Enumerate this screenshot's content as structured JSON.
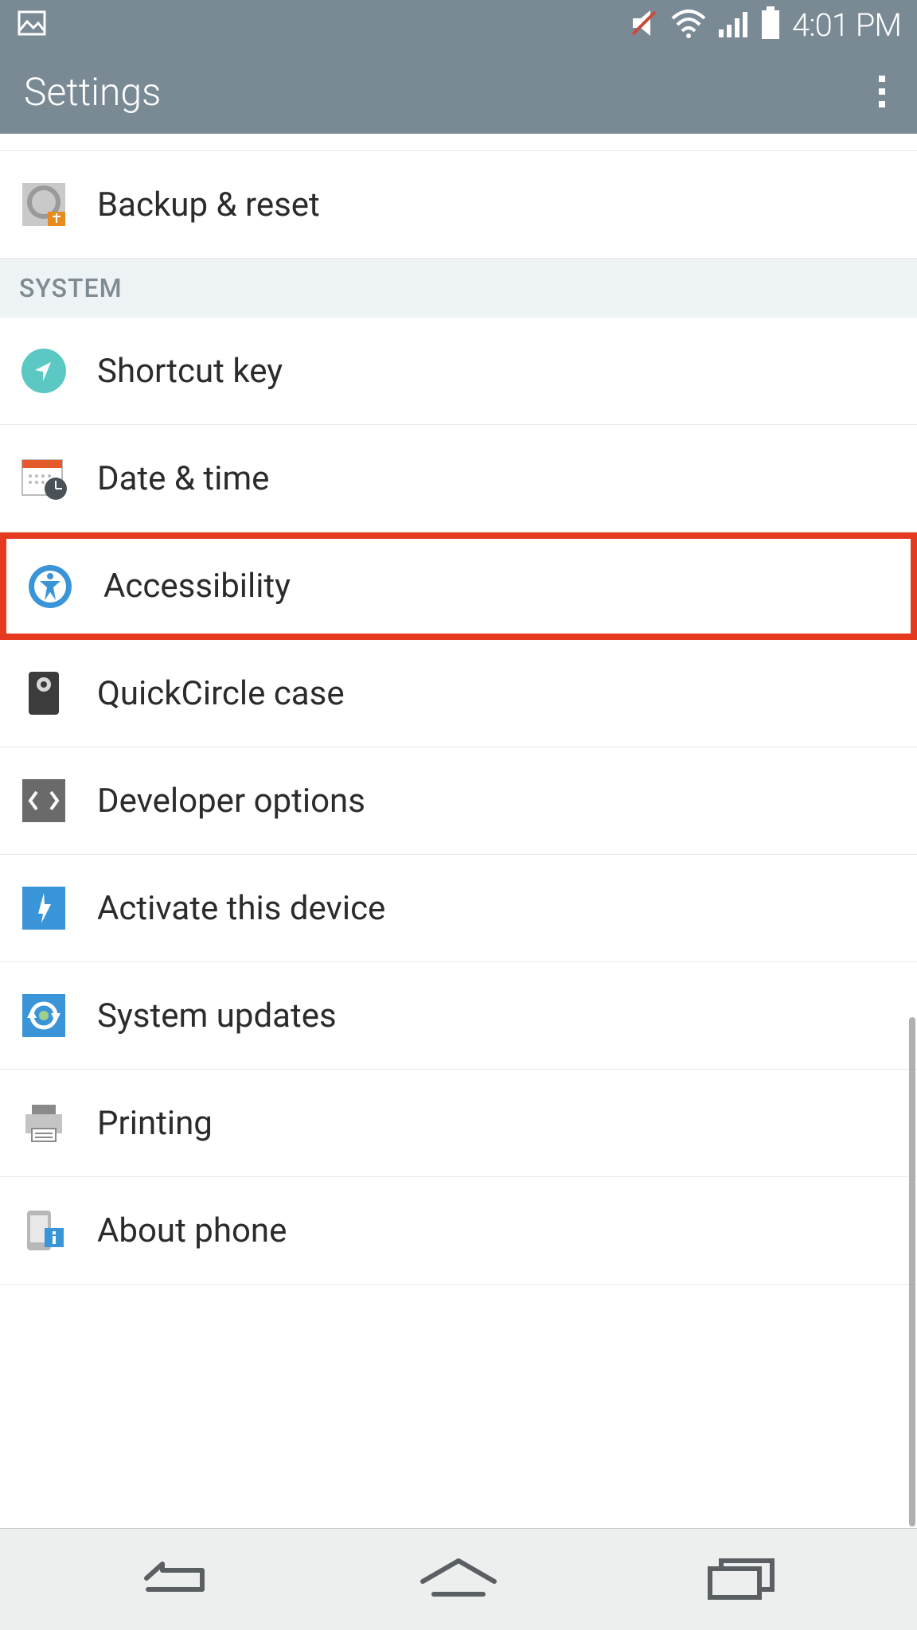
{
  "status_bar": {
    "time": "4:01 PM"
  },
  "app_bar": {
    "title": "Settings"
  },
  "sections": {
    "pre_items": [
      {
        "id": "backup-reset",
        "label": "Backup & reset"
      }
    ],
    "system_header": "SYSTEM",
    "system_items": [
      {
        "id": "shortcut-key",
        "label": "Shortcut key"
      },
      {
        "id": "date-time",
        "label": "Date & time"
      },
      {
        "id": "accessibility",
        "label": "Accessibility",
        "highlighted": true
      },
      {
        "id": "quickcircle",
        "label": "QuickCircle case"
      },
      {
        "id": "developer-options",
        "label": "Developer options"
      },
      {
        "id": "activate-device",
        "label": "Activate this device"
      },
      {
        "id": "system-updates",
        "label": "System updates"
      },
      {
        "id": "printing",
        "label": "Printing"
      },
      {
        "id": "about-phone",
        "label": "About phone"
      }
    ]
  }
}
